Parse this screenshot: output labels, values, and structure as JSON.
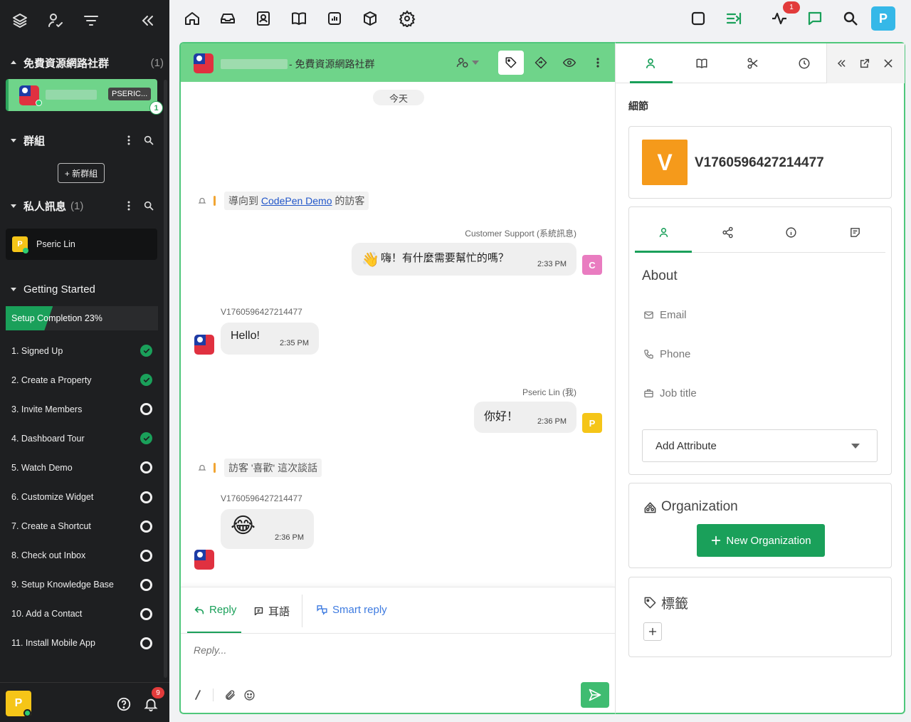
{
  "sidebar": {
    "community": {
      "title": "免費資源網路社群",
      "count": "(1)",
      "item_badge": "PSERIC...",
      "item_unread": "1"
    },
    "groups": {
      "title": "群組",
      "new_button": "+ 新群組"
    },
    "private": {
      "title": "私人訊息",
      "count": "(1)",
      "contact_initial": "P",
      "contact_name": "Pseric Lin"
    },
    "getting_started": {
      "title": "Getting Started",
      "progress_label": "Setup Completion 23%",
      "progress": 0.23,
      "steps": [
        {
          "label": "1. Signed Up",
          "done": true
        },
        {
          "label": "2. Create a Property",
          "done": true
        },
        {
          "label": "3. Invite Members",
          "done": false
        },
        {
          "label": "4. Dashboard Tour",
          "done": true
        },
        {
          "label": "5. Watch Demo",
          "done": false
        },
        {
          "label": "6. Customize Widget",
          "done": false
        },
        {
          "label": "7. Create a Shortcut",
          "done": false
        },
        {
          "label": "8. Check out Inbox",
          "done": false
        },
        {
          "label": "9. Setup Knowledge Base",
          "done": false
        },
        {
          "label": "10. Add a Contact",
          "done": false
        },
        {
          "label": "11. Install Mobile App",
          "done": false
        }
      ]
    },
    "footer": {
      "user_initial": "P",
      "notification_count": "9"
    }
  },
  "topnav": {
    "activity_badge": "1",
    "user_initial": "P"
  },
  "chat": {
    "header_title": "- 免費資源網路社群",
    "date_divider": "今天",
    "system1": {
      "prefix": "導向到 ",
      "link": "CodePen Demo",
      "suffix": " 的訪客"
    },
    "msg1": {
      "sender": "Customer Support (系統訊息)",
      "emoji": "👋",
      "text": "嗨！有什麼需要幫忙的嗎？",
      "time": "2:33 PM",
      "avatar": "C"
    },
    "msg2": {
      "sender": "V1760596427214477",
      "text": "Hello!",
      "time": "2:35 PM"
    },
    "msg3": {
      "sender": "Pseric Lin (我)",
      "text": "你好！",
      "time": "2:36 PM",
      "avatar": "P"
    },
    "system2": {
      "text": "訪客 '喜歡' 這次談話"
    },
    "msg4": {
      "sender": "V1760596427214477",
      "emoji": "😂",
      "time": "2:36 PM"
    }
  },
  "composer": {
    "tab_reply": "Reply",
    "tab_whisper": "耳語",
    "tab_smart": "Smart reply",
    "placeholder": "Reply..."
  },
  "details": {
    "section_title": "細節",
    "visitor_initial": "V",
    "visitor_name": "V1760596427214477",
    "about_title": "About",
    "email_label": "Email",
    "phone_label": "Phone",
    "job_label": "Job title",
    "add_attribute": "Add Attribute",
    "org_title": "Organization",
    "new_org": "New Organization",
    "tags_title": "標籤"
  },
  "colors": {
    "accent": "#1aa05a",
    "header_green": "#6fd48a",
    "brand_blue": "#35b8e8",
    "avatar_orange": "#f59a1b",
    "avatar_yellow": "#f5c518",
    "avatar_pink": "#e97cc0"
  }
}
